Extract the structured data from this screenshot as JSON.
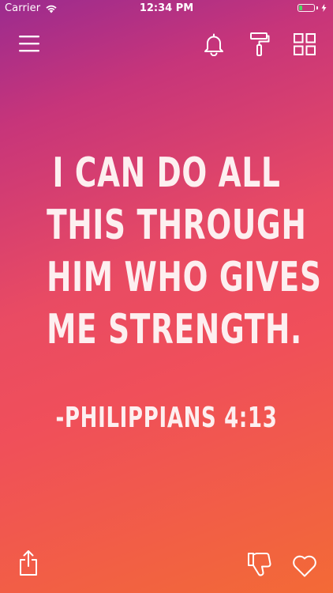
{
  "status_bar": {
    "carrier": "Carrier",
    "time": "12:34 PM",
    "battery_level": 0.2,
    "battery_fill_color": "#4cd964"
  },
  "toolbar": {
    "menu_icon": "hamburger-menu-icon",
    "bell_icon": "bell-icon",
    "brush_icon": "paint-roller-icon",
    "grid_icon": "grid-icon"
  },
  "quote": {
    "lines": [
      "I CAN DO ALL",
      "THIS THROUGH",
      "HIM WHO GIVES",
      "ME STRENGTH."
    ],
    "reference": "-PHILIPPIANS 4:13"
  },
  "bottom_bar": {
    "share_icon": "share-icon",
    "dislike_icon": "thumbs-down-icon",
    "like_icon": "heart-icon"
  },
  "colors": {
    "gradient_top": "#9b2b8f",
    "gradient_mid": "#e94b63",
    "gradient_bottom": "#f36a36",
    "text": "#fdeff0"
  }
}
